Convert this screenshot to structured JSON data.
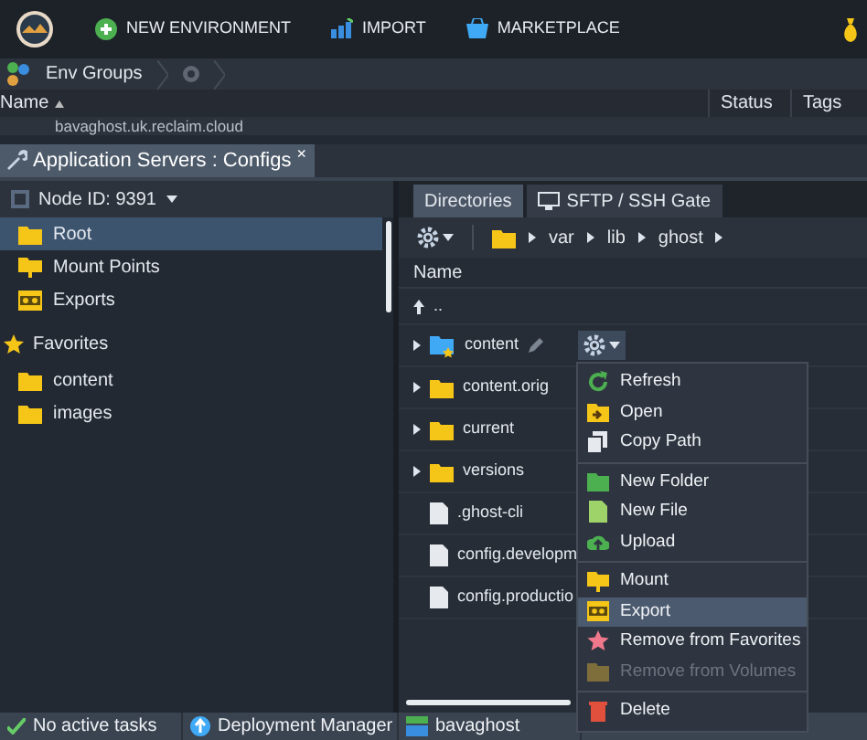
{
  "top_bar": {
    "actions": [
      {
        "kind": "new",
        "label": "NEW ENVIRONMENT"
      },
      {
        "kind": "import",
        "label": "IMPORT"
      },
      {
        "kind": "market",
        "label": "MARKETPLACE"
      }
    ]
  },
  "env_groups": {
    "label": "Env Groups"
  },
  "env_table": {
    "columns": [
      {
        "label": "Name",
        "sorted": true
      },
      {
        "label": "Status",
        "sorted": false
      },
      {
        "label": "Tags",
        "sorted": false
      }
    ],
    "rows": [
      {
        "name": "bavaghost.uk.reclaim.cloud"
      }
    ]
  },
  "panel_tab": {
    "title": "Application Servers : Configs",
    "close": "×"
  },
  "node_selector": {
    "label": "Node ID: 9391"
  },
  "sidebar": {
    "items": [
      {
        "label": "Root",
        "kind": "folder",
        "selected": true
      },
      {
        "label": "Mount Points",
        "kind": "mount",
        "selected": false
      },
      {
        "label": "Exports",
        "kind": "export",
        "selected": false
      }
    ],
    "favorites": {
      "label": "Favorites",
      "items": [
        {
          "label": "content",
          "selected": false
        },
        {
          "label": "images",
          "selected": false
        }
      ]
    }
  },
  "directory_tabs": [
    {
      "label": "Directories",
      "selected": true
    },
    {
      "label": "SFTP / SSH Gate",
      "selected": false
    }
  ],
  "path": [
    "var",
    "lib",
    "ghost"
  ],
  "file_list": {
    "column": "Name",
    "up": "..",
    "rows": [
      {
        "name": "content",
        "kind": "folder",
        "favorite": true
      },
      {
        "name": "content.orig",
        "kind": "folder",
        "favorite": false
      },
      {
        "name": "current",
        "kind": "folder",
        "favorite": false
      },
      {
        "name": "versions",
        "kind": "folder",
        "favorite": false
      },
      {
        "name": ".ghost-cli",
        "kind": "file",
        "favorite": false
      },
      {
        "name": "config.developm",
        "kind": "file",
        "favorite": false
      },
      {
        "name": "config.productio",
        "kind": "file",
        "favorite": false
      }
    ]
  },
  "context_menu": {
    "groups": [
      [
        {
          "label": "Refresh",
          "selected": false,
          "disabled": false
        },
        {
          "label": "Open",
          "selected": false,
          "disabled": false
        },
        {
          "label": "Copy Path",
          "selected": false,
          "disabled": false
        }
      ],
      [
        {
          "label": "New Folder",
          "selected": false,
          "disabled": false
        },
        {
          "label": "New File",
          "selected": false,
          "disabled": false
        },
        {
          "label": "Upload",
          "selected": false,
          "disabled": false
        }
      ],
      [
        {
          "label": "Mount",
          "selected": false,
          "disabled": false
        },
        {
          "label": "Export",
          "selected": true,
          "disabled": false
        },
        {
          "label": "Remove from Favorites",
          "selected": false,
          "disabled": false
        },
        {
          "label": "Remove from Volumes",
          "selected": false,
          "disabled": true
        }
      ],
      [
        {
          "label": "Delete",
          "selected": false,
          "disabled": false
        }
      ]
    ]
  },
  "status_bar": [
    {
      "kind": "tasks",
      "label": "No active tasks"
    },
    {
      "kind": "deploy",
      "label": "Deployment Manager"
    },
    {
      "kind": "env",
      "label": "bavaghost"
    }
  ]
}
